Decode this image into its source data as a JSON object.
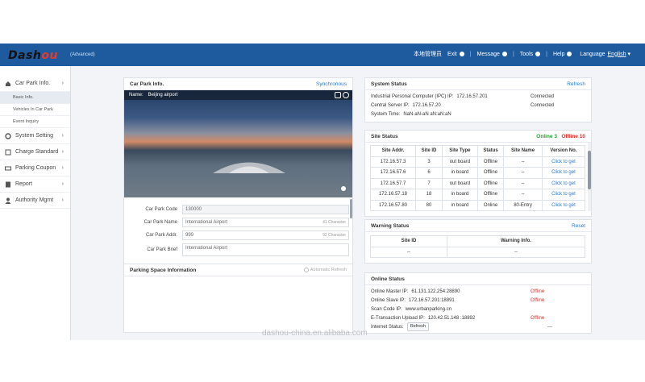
{
  "header": {
    "logo": "DASHOU",
    "edition": "(Advanced)",
    "nav": {
      "lang_cn": "本地管理员",
      "exit": "Exit",
      "message": "Message",
      "tools": "Tools",
      "help": "Help",
      "language_label": "Language",
      "language_value": "English"
    }
  },
  "sidebar": {
    "items": [
      {
        "label": "Car Park Info."
      },
      {
        "label": "System Setting"
      },
      {
        "label": "Charge Standard"
      },
      {
        "label": "Parking Coupon"
      },
      {
        "label": "Report"
      },
      {
        "label": "Authority Mgmt"
      }
    ],
    "sub_items": [
      {
        "label": "Basic Info."
      },
      {
        "label": "Vehicles In Car Park"
      },
      {
        "label": "Event Inquiry"
      }
    ]
  },
  "carpark": {
    "title": "Car Park Info.",
    "sync": "Synchronous",
    "name_label": "Name:",
    "name_value": "Beijing airport",
    "fields": {
      "code_label": "Car Park Code",
      "code_value": "130000",
      "name_label": "Car Park Name",
      "name_value": "International Airport",
      "name_count": "41 Character",
      "addr_label": "Car Park Addr.",
      "addr_value": "999",
      "addr_count": "92 Character",
      "brief_label": "Car Park Brief",
      "brief_value": "International Airport"
    }
  },
  "parking_space": {
    "title": "Parking Space Information",
    "auto_refresh": "Automatic Refresh"
  },
  "system_status": {
    "title": "System Status",
    "refresh": "Refresh",
    "rows": [
      {
        "label": "Industrial Personal Computer (IPC) IP:",
        "value": "172.16.57.201",
        "status": "Connected"
      },
      {
        "label": "Central Server IP:",
        "value": "172.16.57.20",
        "status": "Connected"
      },
      {
        "label": "System Time:",
        "value": "NaN-aN-aN aN:aN:aN",
        "status": ""
      }
    ]
  },
  "site_status": {
    "title": "Site Status",
    "online": "Online 3",
    "offline": "Offline 10",
    "headers": [
      "Site Addr.",
      "Site ID",
      "Site Type",
      "Status",
      "Site Name",
      "Version No."
    ],
    "rows": [
      [
        "172.16.57.3",
        "3",
        "out board",
        "Offline",
        "--",
        "Click to get"
      ],
      [
        "172.16.57.6",
        "6",
        "in board",
        "Offline",
        "--",
        "Click to get"
      ],
      [
        "172.16.57.7",
        "7",
        "out board",
        "Offline",
        "--",
        "Click to get"
      ],
      [
        "172.16.57.18",
        "18",
        "in board",
        "Offline",
        "--",
        "Click to get"
      ],
      [
        "172.16.57.80",
        "80",
        "in board",
        "Online",
        "80-Entry",
        "Click to get"
      ]
    ]
  },
  "warning_status": {
    "title": "Warning Status",
    "reset": "Reset",
    "headers": [
      "Site ID",
      "Warning Info."
    ],
    "row": [
      "--",
      "--"
    ]
  },
  "online_status": {
    "title": "Online Status",
    "rows": [
      {
        "label": "Online Master IP:",
        "value": "61.131.122.254:28890",
        "status": "Offline"
      },
      {
        "label": "Online Slave IP:",
        "value": "172.16.57.201:18891",
        "status": "Offline"
      },
      {
        "label": "Scan Code IP:",
        "value": "www.urbanparking.cn",
        "status": ""
      },
      {
        "label": "E-Transaction Upload IP:",
        "value": "120.42.51.148 :18892",
        "status": "Offline"
      },
      {
        "label": "Internet Status:",
        "value": "",
        "status": "---"
      }
    ],
    "refresh_btn": "Refresh"
  },
  "watermark": "dashou-china.en.alibaba.com",
  "colors": {
    "header": "#1d5b9e",
    "link": "#2a7bd5",
    "offline": "#e0332c",
    "online": "#20a32a"
  }
}
